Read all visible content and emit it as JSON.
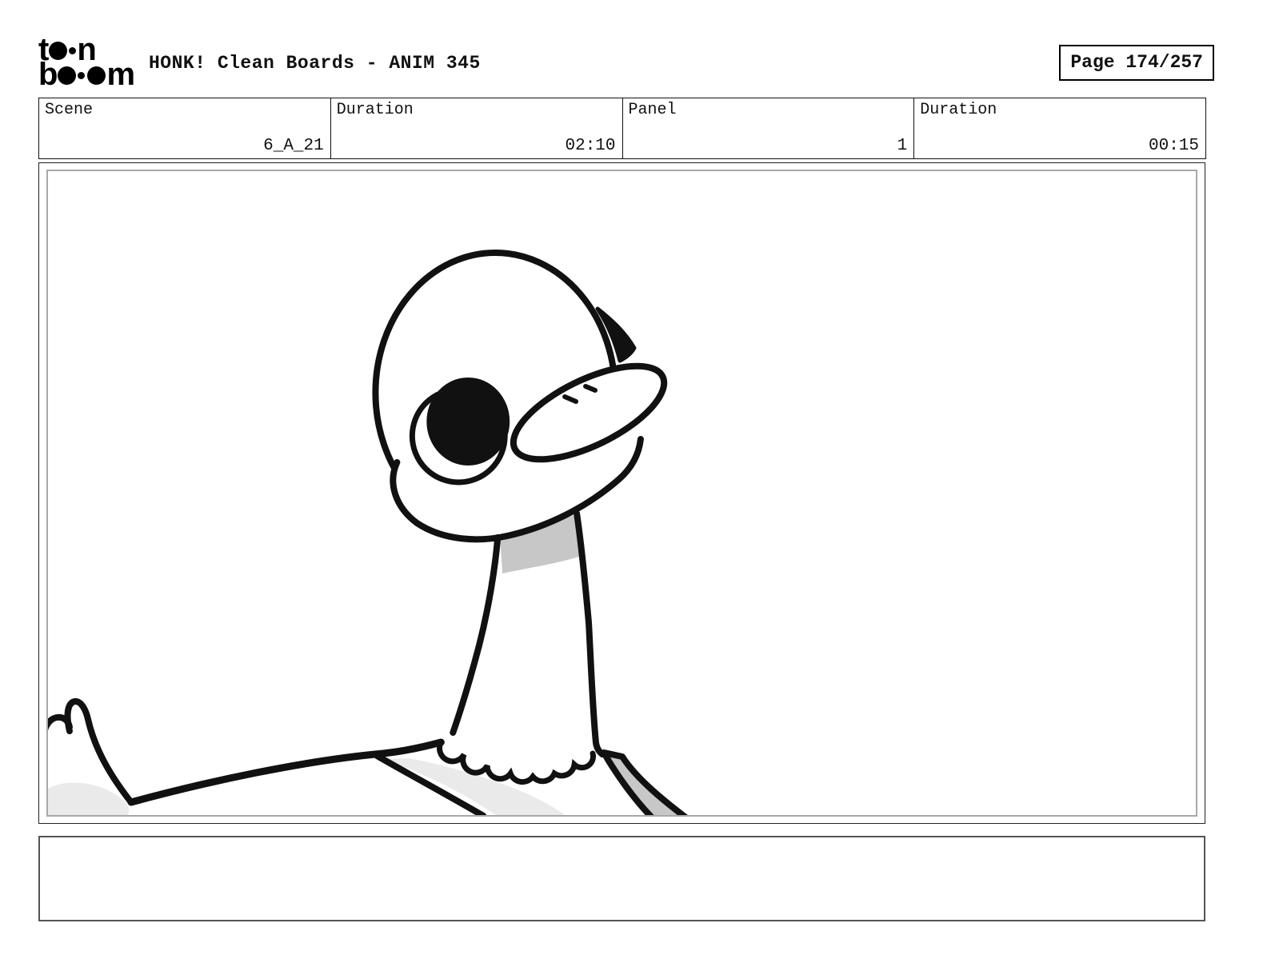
{
  "header": {
    "logo": {
      "r1a": "t",
      "r1b": "n",
      "r2a": "b",
      "r2b": "m",
      "brand": "toon boom"
    },
    "title": "HONK! Clean Boards - ANIM 345",
    "page_label": "Page 174/257"
  },
  "info_row": {
    "cells": [
      {
        "label": "Scene",
        "value": "6_A_21"
      },
      {
        "label": "Duration",
        "value": "02:10"
      },
      {
        "label": "Panel",
        "value": "1"
      },
      {
        "label": "Duration",
        "value": "00:15"
      }
    ]
  },
  "panel": {
    "content": "goose-character-drawing"
  },
  "caption": {
    "text": ""
  },
  "colors": {
    "ink": "#111111",
    "shade_mid": "#c7c7c7",
    "shade_light": "#eaeaea",
    "inner_border": "#a8a8a8"
  }
}
